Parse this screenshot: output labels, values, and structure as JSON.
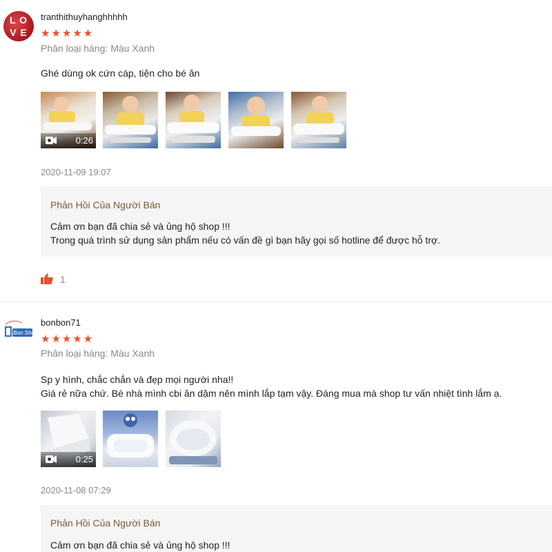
{
  "reviews": [
    {
      "username": "tranthithuyhanghhhhh",
      "stars": "★★★★★",
      "variant": "Phân loại hàng: Màu Xanh",
      "comment_lines": [
        "Ghé dùng ok cứn cáp, tiện cho bé ăn"
      ],
      "video_duration": "0:26",
      "date": "2020-11-09 19:07",
      "reply_title": "Phản Hồi Của Người Bán",
      "reply_lines": [
        "Cảm ơn bạn đã chia sẻ và ủng hộ shop !!!",
        "Trong quá trình sử dụng sản phẩm nếu có vấn đề gì bạn hãy gọi số hotline để được hỗ trợ."
      ],
      "likes": "1"
    },
    {
      "username": "bonbon71",
      "stars": "★★★★★",
      "variant": "Phân loại hàng: Màu Xanh",
      "comment_lines": [
        "Sp y hình, chắc chắn và đẹp mọi người nha!!",
        "Giá rẻ nữa chứ. Bé nhà mình cbi ăn dặm nên mình lắp tạm vậy. Đáng mua mà shop tư vấn nhiệt tình lắm ạ."
      ],
      "video_duration": "0:25",
      "date": "2020-11-08 07:29",
      "reply_title": "Phản Hồi Của Người Bán",
      "reply_lines": [
        "Cảm ơn bạn đã chia sẻ và ủng hộ shop !!!"
      ],
      "avatar_text": "Bon Shop"
    }
  ],
  "colors": {
    "star": "#ee4d2d",
    "reply_title": "#7b5a3a",
    "like": "#ee4d2d"
  }
}
